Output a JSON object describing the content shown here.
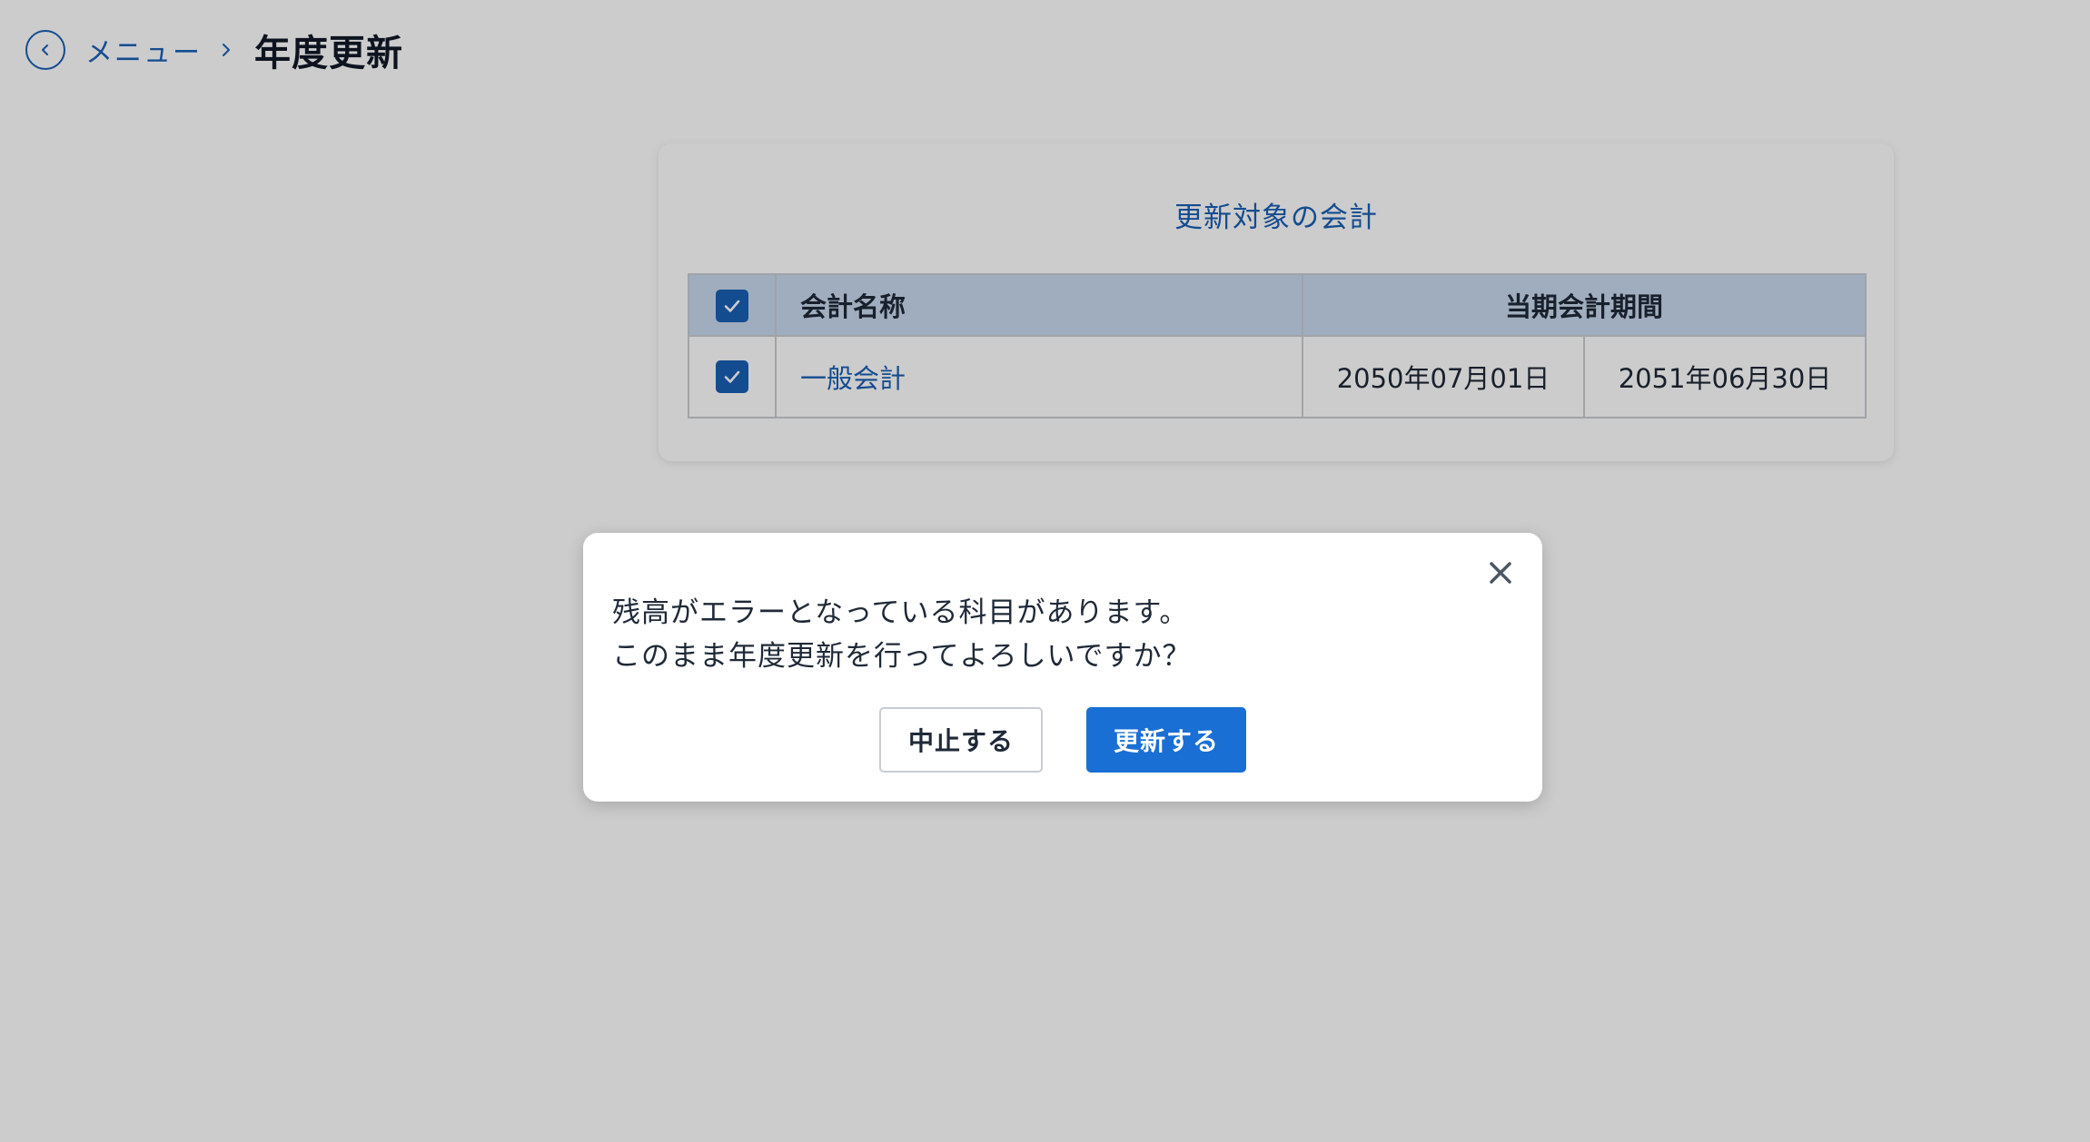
{
  "header": {
    "back_icon": "chevron-left-icon",
    "breadcrumb_menu": "メニュー",
    "separator_icon": "chevron-right-icon",
    "title": "年度更新"
  },
  "card": {
    "title": "更新対象の会計",
    "table": {
      "columns": [
        "会計名称",
        "当期会計期間"
      ],
      "select_all_checked": true,
      "rows": [
        {
          "checked": true,
          "name": "一般会計",
          "period_start": "2050年07月01日",
          "period_end": "2051年06月30日"
        }
      ]
    }
  },
  "dialog": {
    "close_icon": "close-icon",
    "message_line1": "残高がエラーとなっている科目があります。",
    "message_line2": "このまま年度更新を行ってよろしいですか？",
    "cancel_label": "中止する",
    "confirm_label": "更新する"
  },
  "colors": {
    "accent": "#1a5fb4",
    "primary_button": "#1a6fd4",
    "table_header_bg": "#c9d9ee",
    "overlay": "rgba(0,0,0,0.20)"
  }
}
